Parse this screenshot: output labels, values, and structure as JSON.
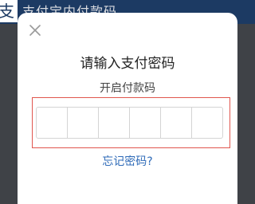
{
  "background": {
    "logo_glyph": "支",
    "title": "支付宝内付款码"
  },
  "dialog": {
    "title": "请输入支付密码",
    "subtitle": "开启付款码",
    "pin_length": 6,
    "forgot_link": "忘记密码?"
  },
  "icons": {
    "close": "close-icon"
  },
  "colors": {
    "overlay": "#3f4247",
    "header_bg": "#1c3a63",
    "highlight_border": "#e0564e",
    "link": "#2f6bb8"
  }
}
